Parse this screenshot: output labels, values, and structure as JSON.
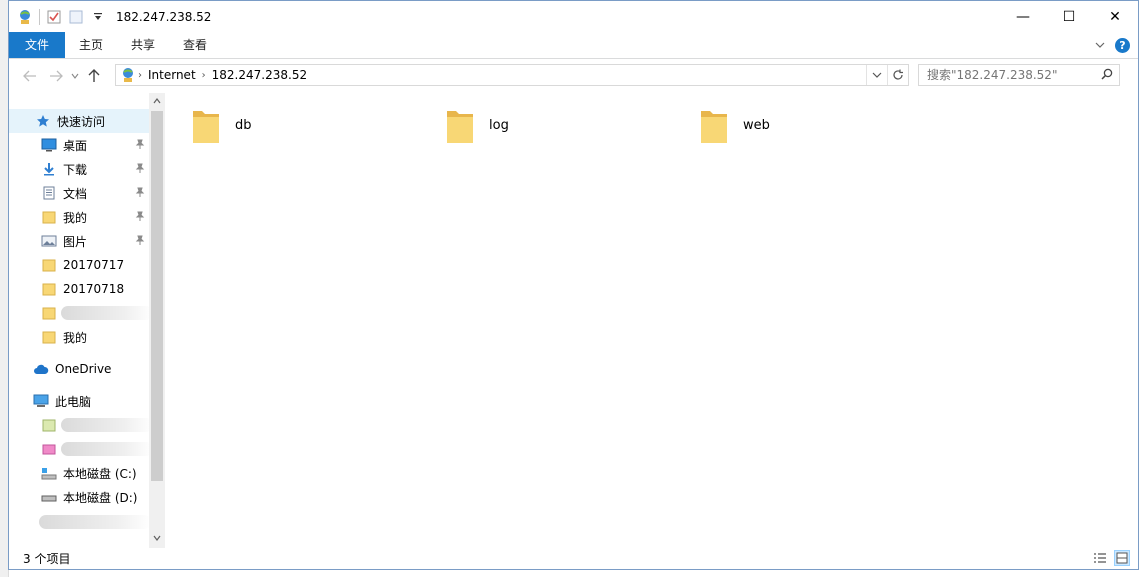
{
  "window": {
    "title": "182.247.238.52",
    "controls": {
      "minimize": "—",
      "maximize": "☐",
      "close": "✕"
    }
  },
  "ribbon": {
    "tabs": [
      {
        "label": "文件"
      },
      {
        "label": "主页"
      },
      {
        "label": "共享"
      },
      {
        "label": "查看"
      }
    ]
  },
  "address_bar": {
    "breadcrumbs": [
      "Internet",
      "182.247.238.52"
    ]
  },
  "search": {
    "placeholder": "搜索\"182.247.238.52\""
  },
  "nav_pane": {
    "quick_access": "快速访问",
    "items": [
      {
        "label": "桌面",
        "icon": "desktop-icon",
        "pinned": true
      },
      {
        "label": "下载",
        "icon": "download-icon",
        "pinned": true
      },
      {
        "label": "文档",
        "icon": "document-icon",
        "pinned": true
      },
      {
        "label": "我的",
        "icon": "folder-icon",
        "pinned": true
      },
      {
        "label": "图片",
        "icon": "pictures-icon",
        "pinned": true
      },
      {
        "label": "20170717",
        "icon": "folder-icon",
        "pinned": false
      },
      {
        "label": "20170718",
        "icon": "folder-icon",
        "pinned": false
      },
      {
        "label": "我的",
        "icon": "folder-icon",
        "pinned": false
      }
    ],
    "onedrive": "OneDrive",
    "this_pc": "此电脑",
    "drives": [
      {
        "label": "本地磁盘 (C:)",
        "icon": "drive-c-icon"
      },
      {
        "label": "本地磁盘 (D:)",
        "icon": "drive-d-icon"
      }
    ]
  },
  "folders": [
    {
      "name": "db"
    },
    {
      "name": "log"
    },
    {
      "name": "web"
    }
  ],
  "status": {
    "item_count": "3 个项目"
  },
  "colors": {
    "accent": "#1979ca",
    "folder": "#f8d775",
    "selection": "#e5f3fb"
  }
}
